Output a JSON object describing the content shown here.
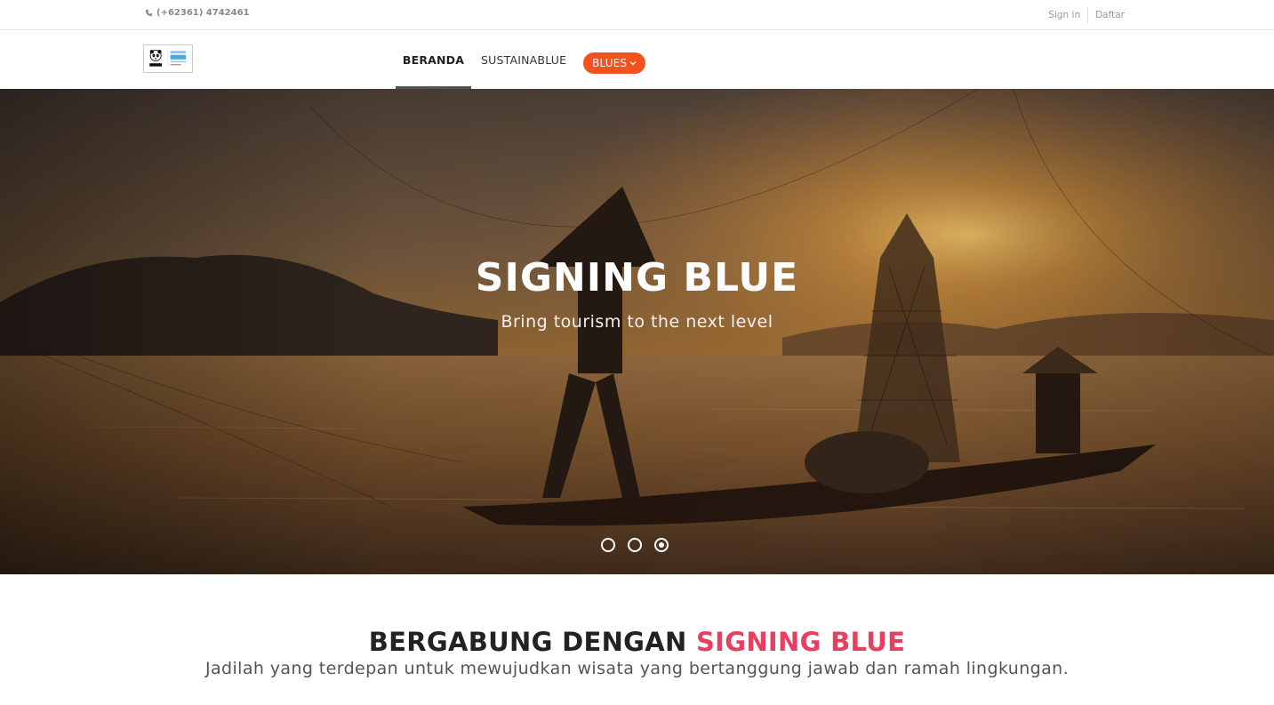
{
  "topbar": {
    "phone": "(+62361) 4742461",
    "signin_label": "Sign in",
    "daftar_label": "Daftar"
  },
  "logo": {
    "brand_text": "WWF",
    "product_text": "BLUE"
  },
  "nav": {
    "items": [
      {
        "label": "BERANDA",
        "active": true
      },
      {
        "label": "SUSTAINABLUE",
        "active": false
      },
      {
        "label": "BLUES",
        "active": false
      }
    ]
  },
  "hero": {
    "title": "SIGNING BLUE",
    "subtitle": "Bring tourism to the next level",
    "slide_count": 3,
    "active_slide": 3
  },
  "join": {
    "title_prefix": "BERGABUNG DENGAN",
    "title_accent": "SIGNING BLUE",
    "subtitle": "Jadilah yang terdepan untuk mewujudkan wisata yang bertanggung jawab dan ramah lingkungan."
  },
  "colors": {
    "accent_orange": "#f4511e",
    "accent_pink": "#e83e5f"
  }
}
